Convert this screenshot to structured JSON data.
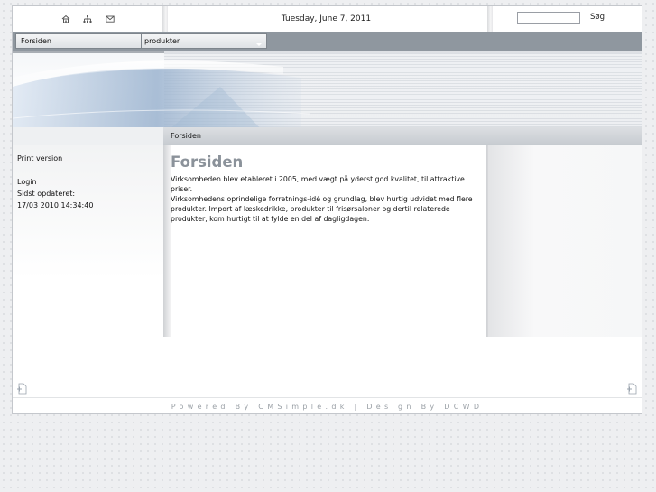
{
  "header": {
    "date": "Tuesday, June 7, 2011",
    "icons": [
      "home-icon",
      "sitemap-icon",
      "mail-icon"
    ],
    "search": {
      "placeholder": "",
      "button_label": "Søg"
    }
  },
  "nav": {
    "items": [
      {
        "label": "Forsiden"
      },
      {
        "label": "produkter"
      }
    ]
  },
  "breadcrumb": "Forsiden",
  "sidebar": {
    "print_label": "Print version",
    "login_label": "Login",
    "last_updated_label": "Sidst opdateret:",
    "last_updated_value": "17/03 2010 14:34:40"
  },
  "main": {
    "title": "Forsiden",
    "paragraph1": "Virksomheden blev etableret i 2005, med vægt på yderst god kvalitet, til attraktive priser.",
    "paragraph2": "Virksomhedens oprindelige forretnings-idé og grundlag, blev hurtig udvidet med flere produkter. Import af læskedrikke, produkter til frisørsaloner og dertil relaterede produkter, kom hurtigt til at fylde en del af dagligdagen."
  },
  "footer": {
    "text": "Powered By CMSimple.dk | Design By DCWD"
  },
  "colors": {
    "nav_bar": "#8f979f",
    "title": "#8b929a",
    "footer_text": "#9aa0a6"
  }
}
